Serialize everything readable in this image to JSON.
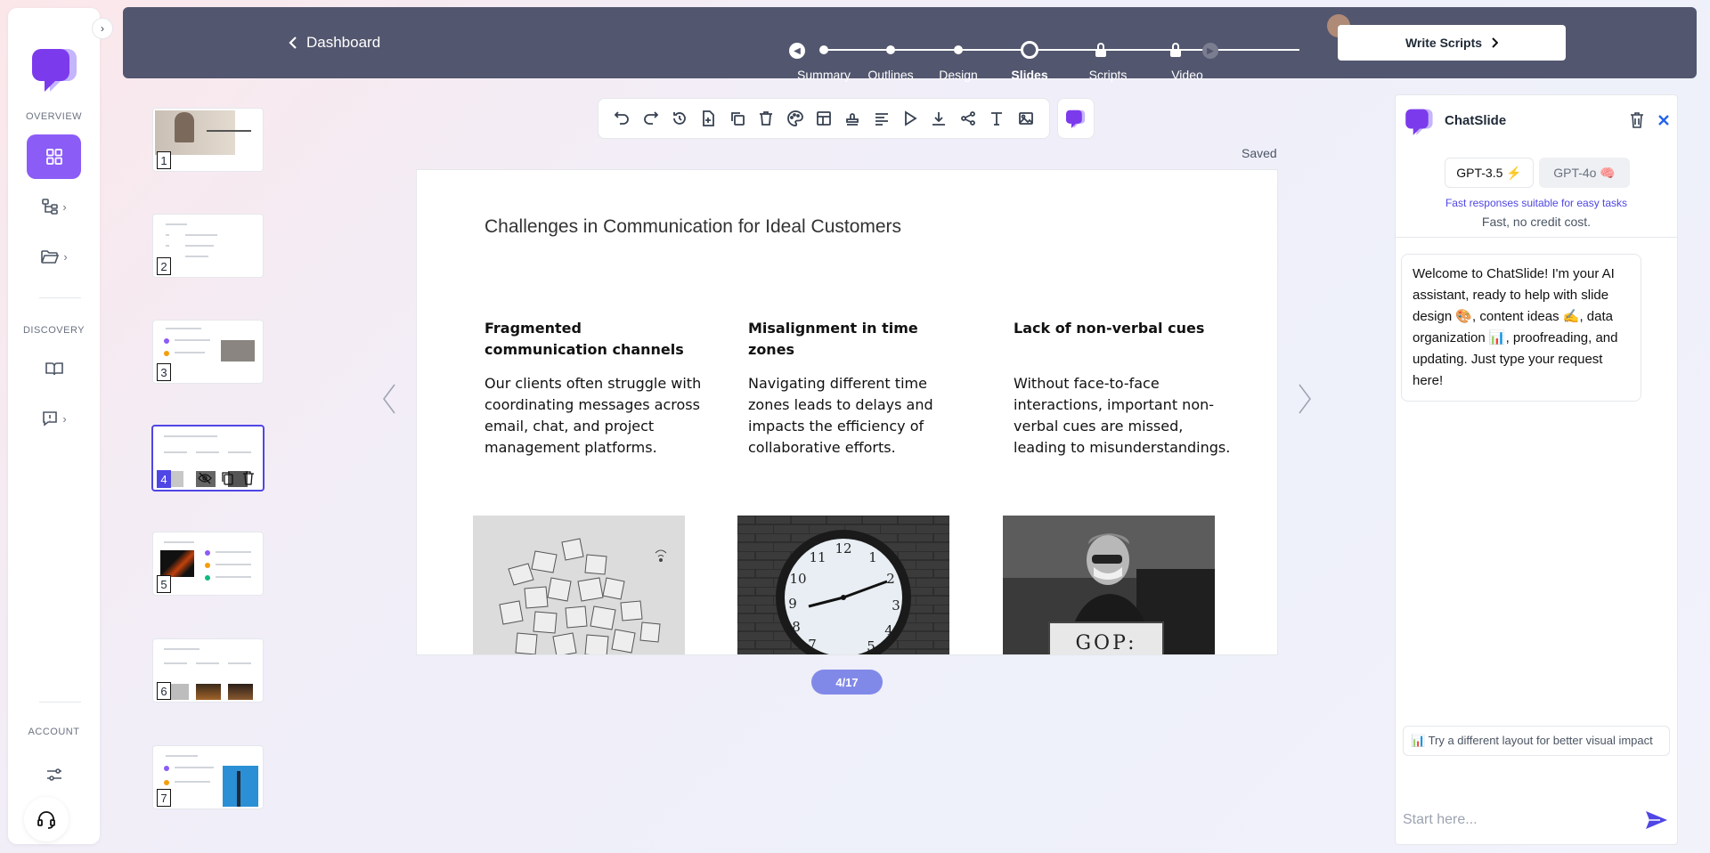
{
  "sidebar": {
    "overview_label": "OVERVIEW",
    "discovery_label": "DISCOVERY",
    "account_label": "ACCOUNT",
    "toggle_icon": "chevron-right-icon"
  },
  "topbar": {
    "back_label": "Dashboard",
    "steps": [
      "Summary",
      "Outlines",
      "Design",
      "Slides",
      "Scripts",
      "Video"
    ],
    "current_step": "Slides",
    "write_scripts_label": "Write Scripts"
  },
  "thumbnails": [
    {
      "number": "1"
    },
    {
      "number": "2"
    },
    {
      "number": "3"
    },
    {
      "number": "4"
    },
    {
      "number": "5"
    },
    {
      "number": "6"
    },
    {
      "number": "7"
    }
  ],
  "editor": {
    "saved_label": "Saved",
    "page_indicator": "4/17"
  },
  "slide": {
    "title": "Challenges in Communication for Ideal Customers",
    "columns": [
      {
        "heading": "Fragmented communication channels",
        "body": "Our clients often struggle with coordinating messages across email, chat, and project management platforms."
      },
      {
        "heading": "Misalignment in time zones",
        "body": "Navigating different time zones leads to delays and impacts the efficiency of collaborative efforts."
      },
      {
        "heading": "Lack of non-verbal cues",
        "body": "Without face-to-face interactions, important non-verbal cues are missed, leading to misunderstandings."
      }
    ],
    "image_sign_text": "GOP:"
  },
  "chat": {
    "title": "ChatSlide",
    "model_gpt35": "GPT-3.5 ⚡",
    "model_gpt4o": "GPT-4o 🧠",
    "model_desc": "Fast responses suitable for easy tasks",
    "model_cost": "Fast, no credit cost.",
    "welcome": "Welcome to ChatSlide! I'm your AI assistant, ready to help with slide design 🎨, content ideas ✍️, data organization 📊, proofreading, and updating. Just type your request here!",
    "suggestion": "📊 Try a different layout for better visual impact",
    "input_placeholder": "Start here..."
  },
  "colors": {
    "accent": "#8b5cf6",
    "topbar": "#52566e",
    "active_thumb": "#4f46e5",
    "page_pill": "#8189e8"
  }
}
